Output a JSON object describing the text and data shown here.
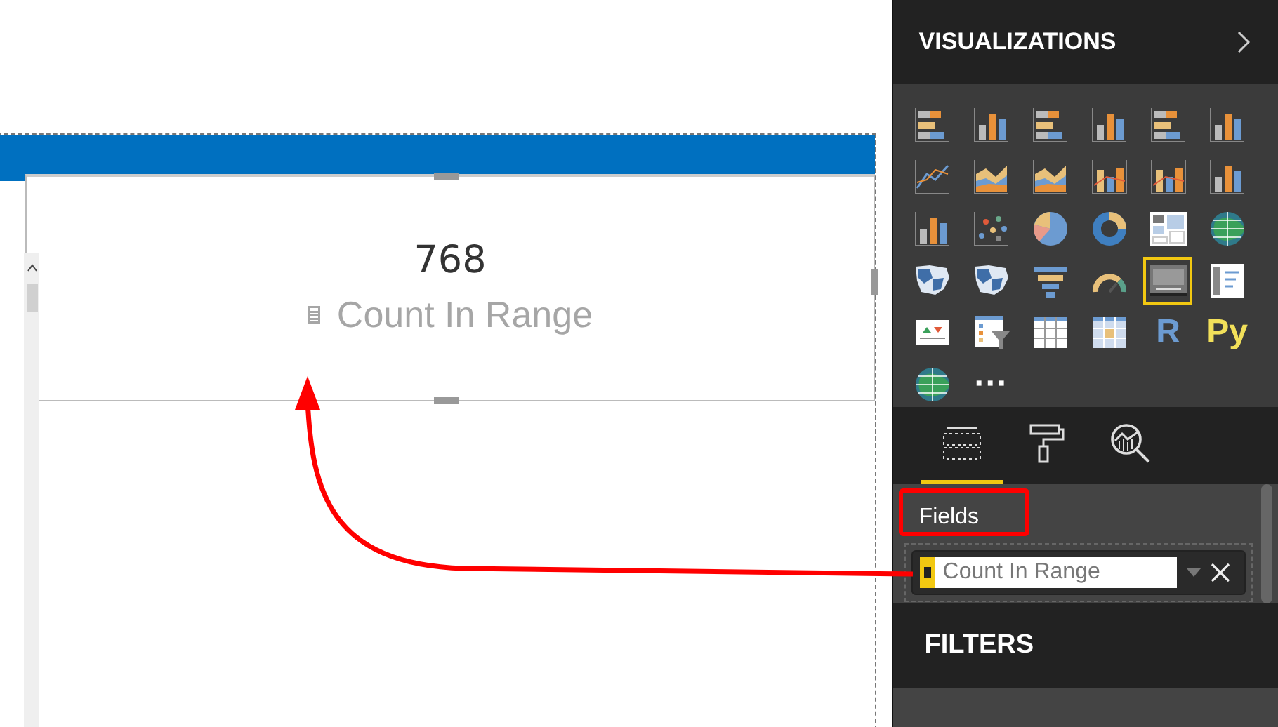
{
  "canvas": {
    "card": {
      "value": "768",
      "label": "Count In Range"
    }
  },
  "visualizations": {
    "title": "VISUALIZATIONS",
    "items": [
      {
        "kind": "hbar",
        "selected": false
      },
      {
        "kind": "col",
        "selected": false
      },
      {
        "kind": "hbar",
        "selected": false
      },
      {
        "kind": "col",
        "selected": false
      },
      {
        "kind": "hbar",
        "selected": false
      },
      {
        "kind": "col",
        "selected": false
      },
      {
        "kind": "line",
        "selected": false
      },
      {
        "kind": "area",
        "selected": false
      },
      {
        "kind": "area",
        "selected": false
      },
      {
        "kind": "combo",
        "selected": false
      },
      {
        "kind": "combo",
        "selected": false
      },
      {
        "kind": "col",
        "selected": false
      },
      {
        "kind": "col",
        "selected": false
      },
      {
        "kind": "scatter",
        "selected": false
      },
      {
        "kind": "pie",
        "selected": false
      },
      {
        "kind": "donut",
        "selected": false
      },
      {
        "kind": "treemap",
        "selected": false
      },
      {
        "kind": "globe",
        "selected": false
      },
      {
        "kind": "map",
        "selected": false
      },
      {
        "kind": "map",
        "selected": false
      },
      {
        "kind": "funnel",
        "selected": false
      },
      {
        "kind": "gauge",
        "selected": false
      },
      {
        "kind": "card",
        "selected": true
      },
      {
        "kind": "list",
        "selected": false
      },
      {
        "kind": "kpi",
        "selected": false
      },
      {
        "kind": "slicer",
        "selected": false
      },
      {
        "kind": "table",
        "selected": false
      },
      {
        "kind": "matrix",
        "selected": false
      },
      {
        "kind": "letter",
        "text": "R",
        "color": "#6c9bd1",
        "selected": false
      },
      {
        "kind": "letter",
        "text": "Py",
        "color": "#f2e05a",
        "selected": false
      },
      {
        "kind": "globe",
        "selected": false
      },
      {
        "kind": "letter",
        "text": "···",
        "color": "#ffffff",
        "selected": false
      }
    ]
  },
  "pane_tabs": [
    {
      "kind": "fields",
      "selected": true
    },
    {
      "kind": "format",
      "selected": false
    },
    {
      "kind": "analytics",
      "selected": false
    }
  ],
  "fields": {
    "title": "Fields",
    "value": "Count In Range"
  },
  "filters": {
    "title": "FILTERS"
  }
}
